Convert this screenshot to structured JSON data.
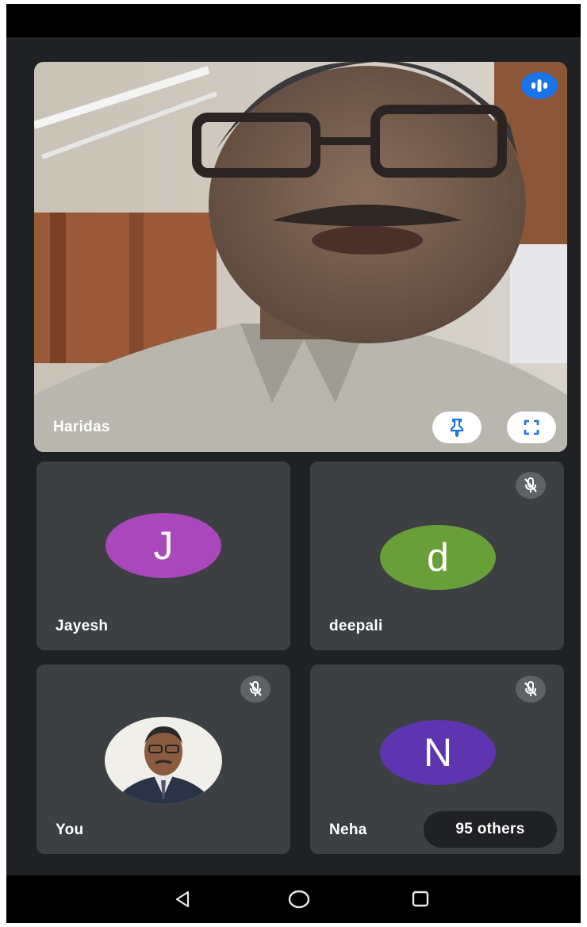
{
  "colors": {
    "background": "#202124",
    "tile": "#3c4043",
    "accent_blue": "#1a73e8",
    "avatar_jayesh": "#ab47bc",
    "avatar_deepali": "#689f38",
    "avatar_neha": "#5e35b1"
  },
  "featured": {
    "name": "Haridas",
    "speaking_icon": "audio-bars-icon",
    "pin_icon": "pin-icon",
    "fullscreen_icon": "fullscreen-icon"
  },
  "participants": [
    {
      "name": "Jayesh",
      "initial": "J",
      "muted": false
    },
    {
      "name": "deepali",
      "initial": "d",
      "muted": true
    },
    {
      "name": "You",
      "photo": true,
      "muted": true
    },
    {
      "name": "Neha",
      "initial": "N",
      "muted": true
    }
  ],
  "others": {
    "label": "95 others"
  },
  "navigation": {
    "back_icon": "back-triangle-icon",
    "home_icon": "home-circle-icon",
    "recents_icon": "recents-square-icon"
  }
}
